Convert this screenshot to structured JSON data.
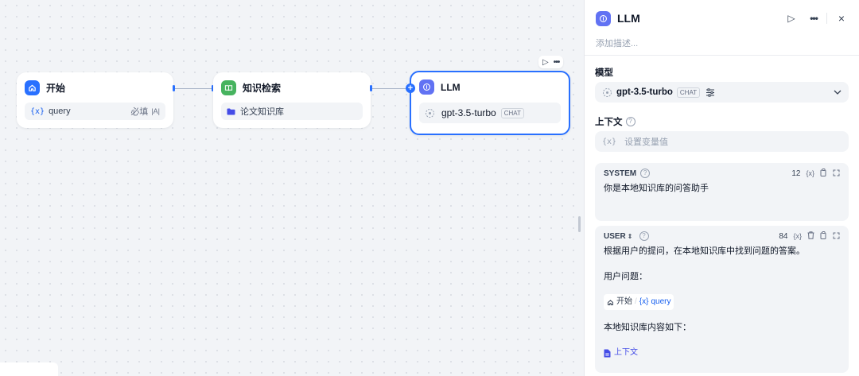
{
  "nodes": {
    "start": {
      "title": "开始",
      "var_glyph": "{x}",
      "var_name": "query",
      "required_label": "必填",
      "type_badge": "|A|"
    },
    "knowledge": {
      "title": "知识检索",
      "dataset": "论文知识库"
    },
    "llm": {
      "title": "LLM",
      "model": "gpt-3.5-turbo",
      "mode_badge": "CHAT",
      "add_symbol": "+"
    }
  },
  "toolbar": {
    "run_icon": "play-icon",
    "more_icon": "more-icon"
  },
  "panel": {
    "title": "LLM",
    "description_placeholder": "添加描述...",
    "model_section": {
      "label": "模型",
      "model_name": "gpt-3.5-turbo",
      "mode_badge": "CHAT"
    },
    "context_section": {
      "label": "上下文",
      "placeholder": "设置变量值"
    },
    "system_prompt": {
      "role": "SYSTEM",
      "token_count": "12",
      "var_glyph": "{x}",
      "text": "你是本地知识库的问答助手"
    },
    "user_prompt": {
      "role": "USER",
      "token_count": "84",
      "var_glyph": "{x}",
      "line1": "根据用户的提问，在本地知识库中找到问题的答案。",
      "line2": "用户问题：",
      "var_node": "开始",
      "var_separator": "/",
      "var_name": "query",
      "line3": "本地知识库内容如下：",
      "context_chip": "上下文"
    }
  },
  "colors": {
    "accent": "#2970ff",
    "start_icon": "#2970ff",
    "knowledge_icon": "#47b35f",
    "llm_icon": "#6172f3",
    "context_chip": "#444ce7"
  }
}
